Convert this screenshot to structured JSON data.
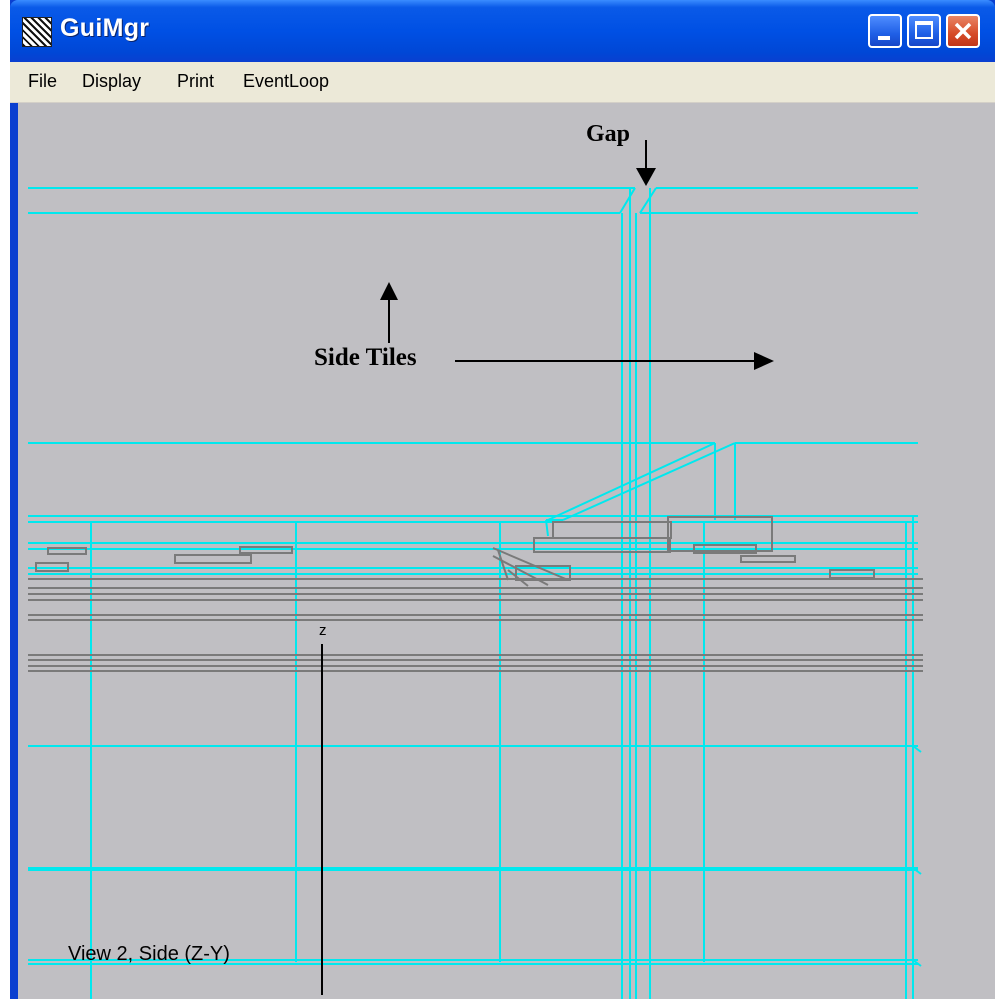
{
  "window": {
    "title": "GuiMgr",
    "icon": "app-icon"
  },
  "title_buttons": {
    "minimize": "minimize-icon",
    "maximize": "maximize-icon",
    "close": "close-icon"
  },
  "menu": {
    "items": [
      "File",
      "Display",
      "Print",
      "EventLoop"
    ]
  },
  "canvas": {
    "view_label": "View 2, Side (Z-Y)",
    "axis_label": "z",
    "annotations": {
      "gap": "Gap",
      "side_tiles": "Side Tiles"
    }
  },
  "colors": {
    "titlebar": "#0050e4",
    "menubar": "#ece9d8",
    "canvas_bg": "#c0bfc3",
    "geometry_cyan": "#00e8ee",
    "geometry_gray": "#7a7a7a",
    "close_button": "#d64a26"
  }
}
